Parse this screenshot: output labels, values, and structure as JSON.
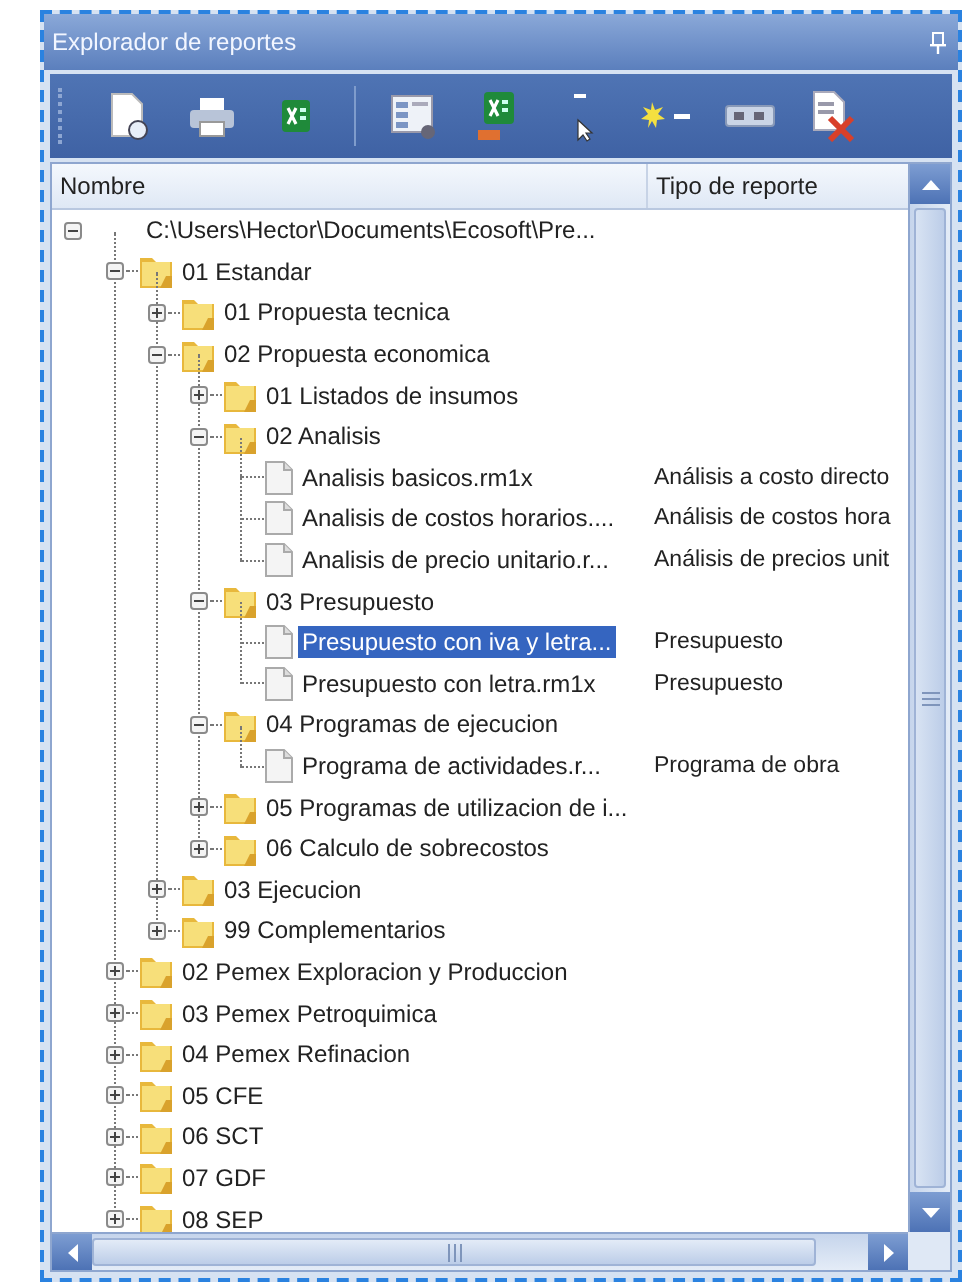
{
  "panel": {
    "title": "Explorador de reportes"
  },
  "toolbar": [
    {
      "kind": "new-report"
    },
    {
      "kind": "print"
    },
    {
      "kind": "excel"
    },
    {
      "kind": "separator"
    },
    {
      "kind": "layout"
    },
    {
      "kind": "excel-export"
    },
    {
      "kind": "cursor"
    },
    {
      "kind": "star"
    },
    {
      "kind": "ab"
    },
    {
      "kind": "delete"
    }
  ],
  "columns": [
    "Nombre",
    "Tipo de reporte"
  ],
  "tree": [
    {
      "kind": "root",
      "name": "C:\\Users\\Hector\\Documents\\Ecosoft\\Pre...",
      "expanded": true,
      "selected": false,
      "children": [
        {
          "kind": "folder",
          "name": "01 Estandar",
          "expanded": true,
          "selected": false,
          "children": [
            {
              "kind": "folder",
              "name": "01 Propuesta tecnica",
              "expanded": false,
              "selected": false
            },
            {
              "kind": "folder",
              "name": "02 Propuesta economica",
              "expanded": true,
              "selected": false,
              "children": [
                {
                  "kind": "folder",
                  "name": "01 Listados de insumos",
                  "expanded": false,
                  "selected": false
                },
                {
                  "kind": "folder",
                  "name": "02 Analisis",
                  "expanded": true,
                  "selected": false,
                  "children": [
                    {
                      "kind": "file",
                      "name": "Analisis basicos.rm1x",
                      "type": "Análisis a costo directo",
                      "selected": false
                    },
                    {
                      "kind": "file",
                      "name": "Analisis de costos horarios....",
                      "type": "Análisis de costos hora",
                      "selected": false
                    },
                    {
                      "kind": "file",
                      "name": "Analisis de precio unitario.r...",
                      "type": "Análisis de precios unit",
                      "selected": false
                    }
                  ]
                },
                {
                  "kind": "folder",
                  "name": "03 Presupuesto",
                  "expanded": true,
                  "selected": false,
                  "children": [
                    {
                      "kind": "file",
                      "name": "Presupuesto con iva y letra...",
                      "type": "Presupuesto",
                      "selected": true
                    },
                    {
                      "kind": "file",
                      "name": "Presupuesto con letra.rm1x",
                      "type": "Presupuesto",
                      "selected": false
                    }
                  ]
                },
                {
                  "kind": "folder",
                  "name": "04 Programas de ejecucion",
                  "expanded": true,
                  "selected": false,
                  "children": [
                    {
                      "kind": "file",
                      "name": "Programa de actividades.r...",
                      "type": "Programa de obra",
                      "selected": false
                    }
                  ]
                },
                {
                  "kind": "folder",
                  "name": "05 Programas de utilizacion de i...",
                  "expanded": false,
                  "selected": false
                },
                {
                  "kind": "folder",
                  "name": "06 Calculo de sobrecostos",
                  "expanded": false,
                  "selected": false
                }
              ]
            },
            {
              "kind": "folder",
              "name": "03 Ejecucion",
              "expanded": false,
              "selected": false
            },
            {
              "kind": "folder",
              "name": "99 Complementarios",
              "expanded": false,
              "selected": false
            }
          ]
        },
        {
          "kind": "folder",
          "name": "02 Pemex Exploracion y Produccion",
          "expanded": false,
          "selected": false
        },
        {
          "kind": "folder",
          "name": "03 Pemex Petroquimica",
          "expanded": false,
          "selected": false
        },
        {
          "kind": "folder",
          "name": "04 Pemex Refinacion",
          "expanded": false,
          "selected": false
        },
        {
          "kind": "folder",
          "name": "05 CFE",
          "expanded": false,
          "selected": false
        },
        {
          "kind": "folder",
          "name": "06 SCT",
          "expanded": false,
          "selected": false
        },
        {
          "kind": "folder",
          "name": "07 GDF",
          "expanded": false,
          "selected": false
        },
        {
          "kind": "folder",
          "name": "08 SEP",
          "expanded": false,
          "selected": false
        }
      ]
    }
  ]
}
